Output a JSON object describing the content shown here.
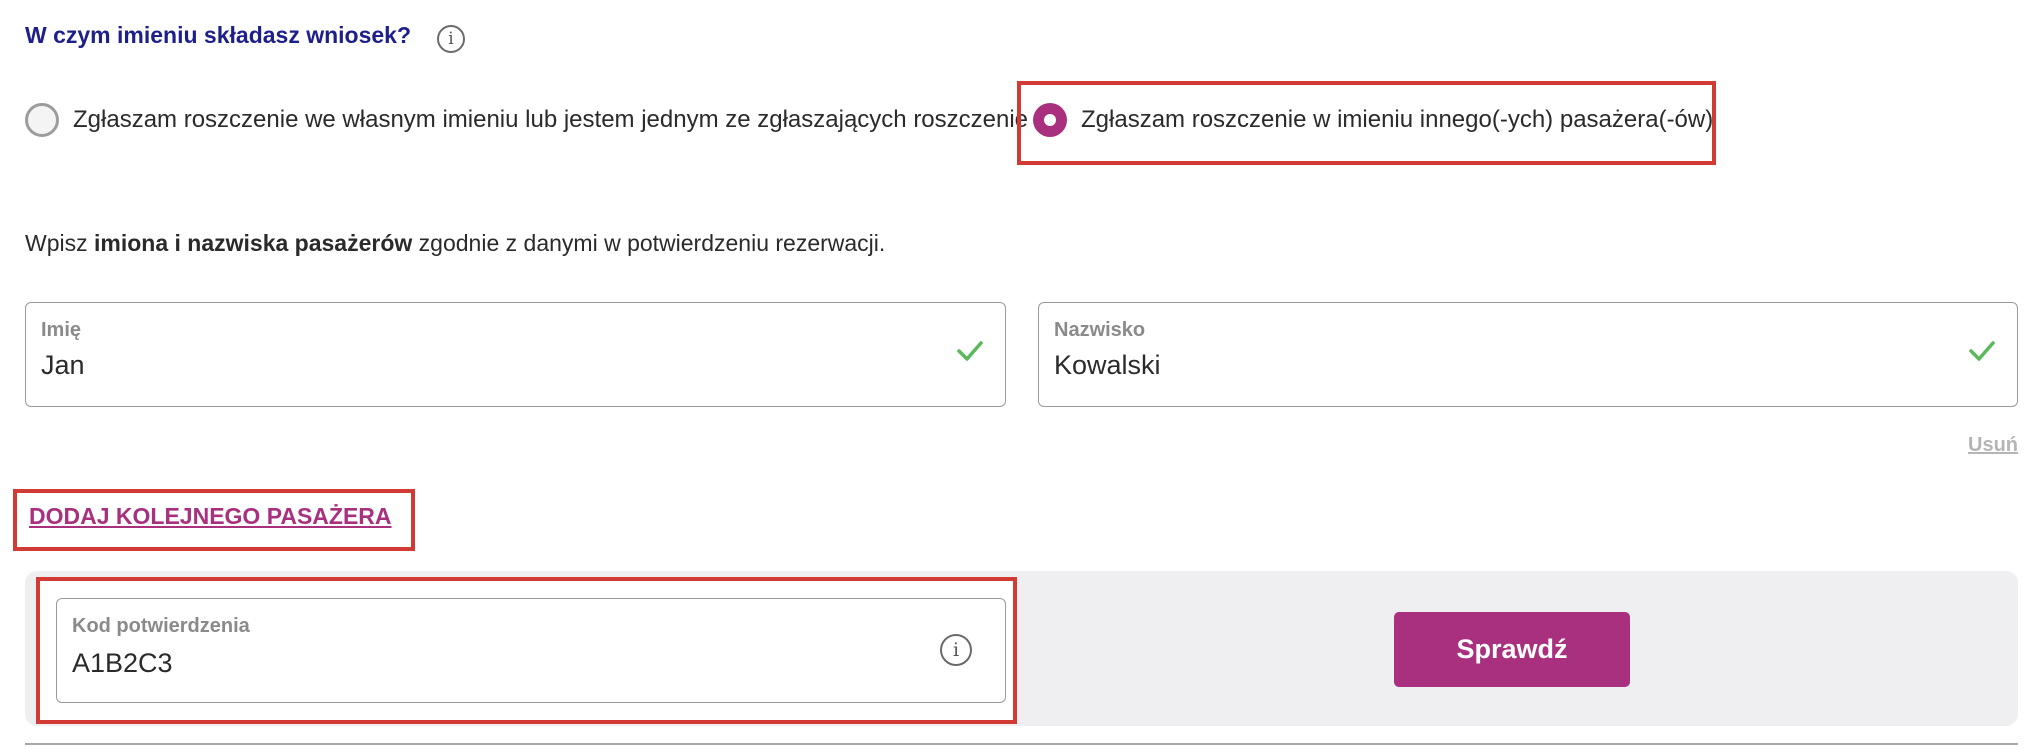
{
  "question": {
    "text": "W czym imieniu składasz wniosek?",
    "info_glyph": "i"
  },
  "claim_options": [
    {
      "label": "Zgłaszam roszczenie we własnym imieniu lub jestem jednym ze zgłaszających roszczenie",
      "selected": false
    },
    {
      "label": "Zgłaszam roszczenie w imieniu innego(-ych) pasażera(-ów)",
      "selected": true
    }
  ],
  "instruction": {
    "prefix": "Wpisz ",
    "bold": "imiona i nazwiska pasażerów",
    "suffix": " zgodnie z danymi w potwierdzeniu rezerwacji."
  },
  "passenger": {
    "first_name_label": "Imię",
    "first_name_value": "Jan",
    "last_name_label": "Nazwisko",
    "last_name_value": "Kowalski",
    "remove_label": "Usuń"
  },
  "add_passenger_label": "DODAJ KOLEJNEGO PASAŻERA",
  "confirmation": {
    "label": "Kod potwierdzenia",
    "value": "A1B2C3",
    "info_glyph": "i",
    "check_button_label": "Sprawdź"
  },
  "colors": {
    "accent": "#a8307e",
    "heading": "#1d1f8a",
    "valid_check": "#5cb85c",
    "highlight_outline": "#d13b33"
  }
}
